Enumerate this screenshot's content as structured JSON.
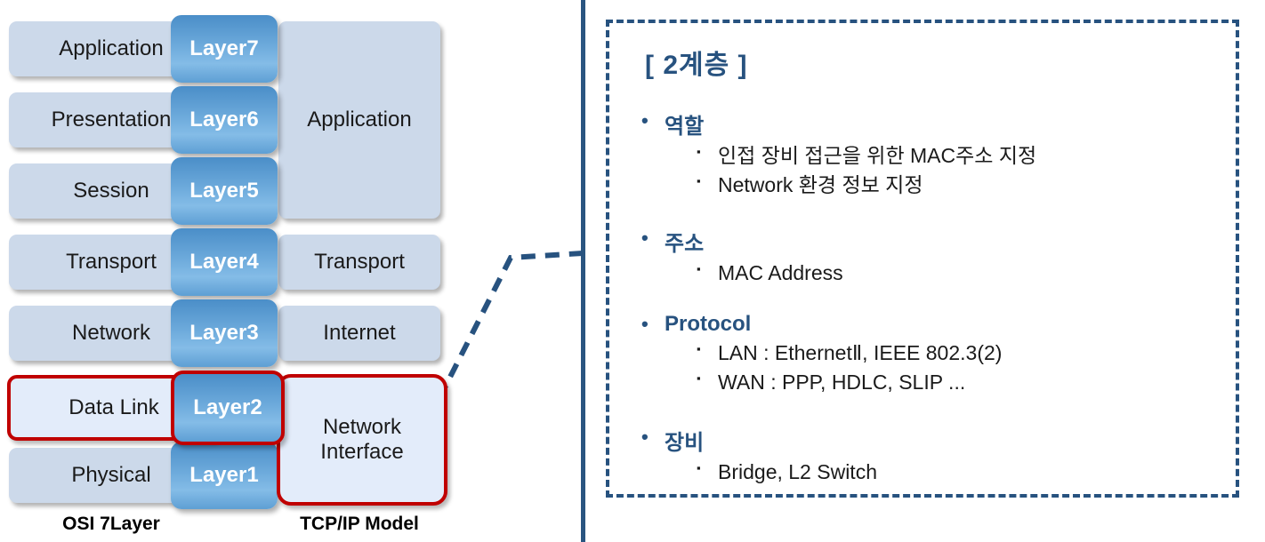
{
  "diagram": {
    "osi": {
      "caption": "OSI 7Layer",
      "layers": [
        {
          "name": "Application",
          "highlight": false
        },
        {
          "name": "Presentation",
          "highlight": false
        },
        {
          "name": "Session",
          "highlight": false
        },
        {
          "name": "Transport",
          "highlight": false
        },
        {
          "name": "Network",
          "highlight": false
        },
        {
          "name": "Data Link",
          "highlight": true
        },
        {
          "name": "Physical",
          "highlight": false
        }
      ]
    },
    "layer_column": {
      "labels": [
        "Layer7",
        "Layer6",
        "Layer5",
        "Layer4",
        "Layer3",
        "Layer2",
        "Layer1"
      ],
      "highlighted": "Layer2"
    },
    "tcpip": {
      "caption": "TCP/IP Model",
      "layers": [
        {
          "name": "Application",
          "spans": "Layer7-Layer5",
          "highlight": false
        },
        {
          "name": "Transport",
          "spans": "Layer4",
          "highlight": false
        },
        {
          "name": "Internet",
          "spans": "Layer3",
          "highlight": false
        },
        {
          "name": "Network Interface",
          "spans": "Layer2-Layer1",
          "highlight": true
        }
      ]
    },
    "colors": {
      "layer_blue_dark": "#4a8ec8",
      "layer_blue_light": "#84bce7",
      "box_fill": "#ccd9ea",
      "highlight_border": "#c00000",
      "highlight_fill": "#e3ecfa",
      "connector": "#27527f"
    }
  },
  "detail": {
    "title": "[ 2계층 ]",
    "sections": [
      {
        "heading": "역할",
        "items": [
          "인접 장비 접근을 위한 MAC주소 지정",
          "Network 환경 정보 지정"
        ]
      },
      {
        "heading": "주소",
        "items": [
          "MAC Address"
        ]
      },
      {
        "heading": "Protocol",
        "items": [
          "LAN : EthernetⅡ, IEEE 802.3(2)",
          "WAN : PPP, HDLC, SLIP ..."
        ]
      },
      {
        "heading": "장비",
        "items": [
          "Bridge, L2 Switch"
        ]
      }
    ],
    "bullet_main": "•",
    "bullet_sub": "▪"
  }
}
